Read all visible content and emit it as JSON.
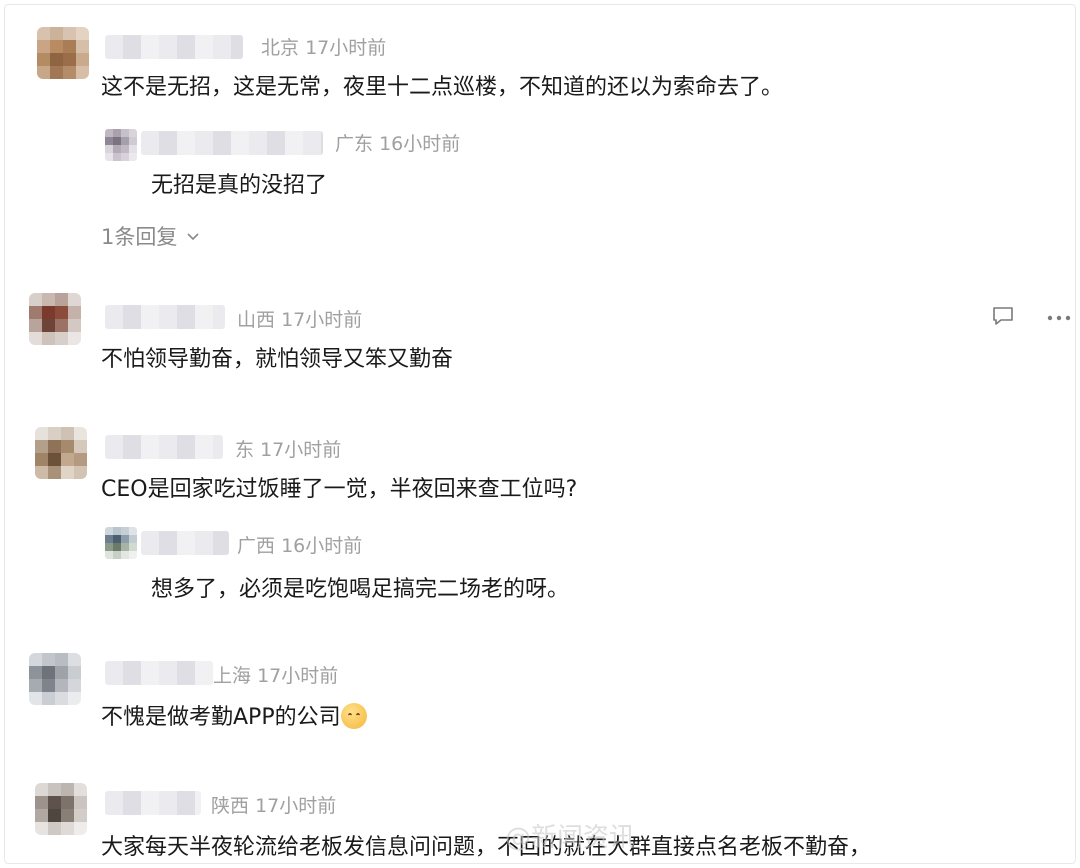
{
  "comments": [
    {
      "location": "北京",
      "time": "17小时前",
      "text": "这不是无招，这是无常，夜里十二点巡楼，不知道的还以为索命去了。",
      "reply": {
        "location": "广东",
        "time": "16小时前",
        "text": "无招是真的没招了"
      },
      "more_replies": "1条回复"
    },
    {
      "location": "山西",
      "time": "17小时前",
      "text": "不怕领导勤奋，就怕领导又笨又勤奋"
    },
    {
      "location": "东",
      "time": "17小时前",
      "text": "CEO是回家吃过饭睡了一觉，半夜回来查工位吗?",
      "reply": {
        "location": "广西",
        "time": "16小时前",
        "text": "想多了，必须是吃饱喝足搞完二场老的呀。"
      }
    },
    {
      "location": "上海",
      "time": "17小时前",
      "text": "不愧是做考勤APP的公司"
    },
    {
      "location": "陕西",
      "time": "17小时前",
      "text": "大家每天半夜轮流给老板发信息问问题，不回的就在大群直接点名老板不勤奋，"
    }
  ],
  "icons": {
    "comment": "comment-icon",
    "more": "more-icon",
    "emoji": "sleepy-face-emoji"
  },
  "watermark": "@新闻资讯"
}
